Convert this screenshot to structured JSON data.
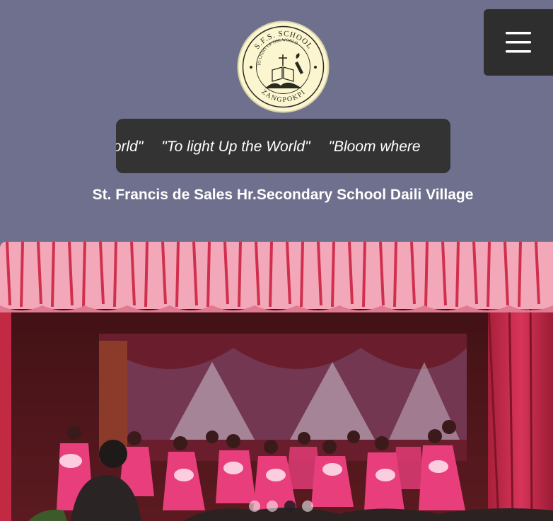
{
  "logo": {
    "top_text": "S.F.S. SCHOOL",
    "motto": "TO LIGHT UP THE WORLD",
    "bottom_text": "ZANGPOKPI"
  },
  "menu": {
    "icon": "hamburger-icon"
  },
  "ticker": {
    "items": [
      "World\"",
      "\"To light Up the World\"",
      "\"Bloom where"
    ]
  },
  "school_name": "St. Francis de Sales Hr.Secondary School Daili Village",
  "carousel": {
    "slide_count": 4,
    "active_index": 2,
    "colors": {
      "curtain": "#c8284a",
      "dress": "#e83f7c",
      "valance": "#f2a8b8"
    }
  }
}
